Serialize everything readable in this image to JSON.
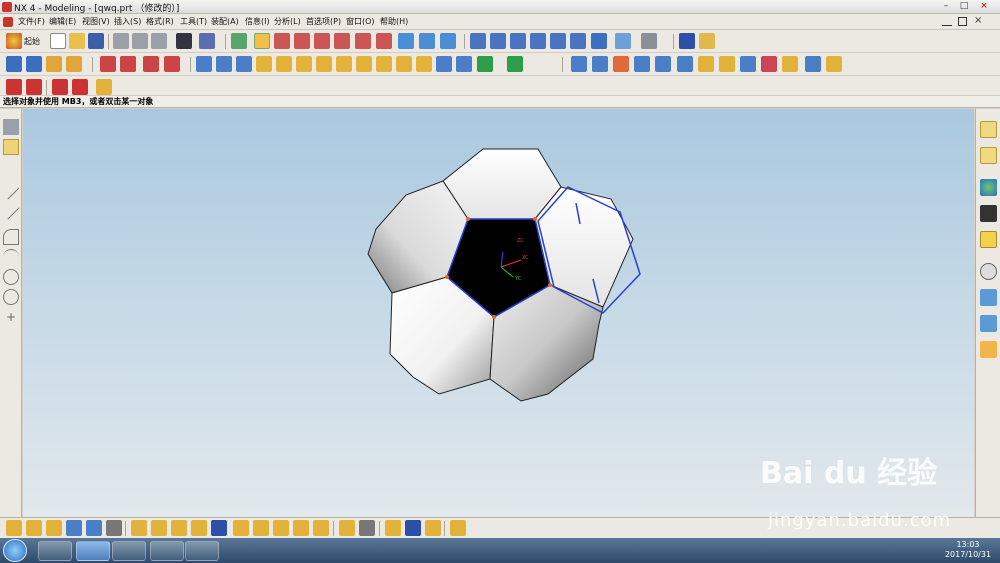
{
  "window": {
    "title": "NX 4 - Modeling - [qwq.prt （修改的）]",
    "controls": [
      "–",
      "□",
      "×"
    ]
  },
  "menu": {
    "items": [
      "文件(F)",
      "编辑(E)",
      "视图(V)",
      "插入(S)",
      "格式(R)",
      "工具(T)",
      "装配(A)",
      "信息(I)",
      "分析(L)",
      "首选项(P)",
      "窗口(O)",
      "帮助(H)"
    ]
  },
  "toolbar": {
    "start_label": "起始"
  },
  "status": {
    "message": "选择对象并使用 MB3，或者双击某一对象"
  },
  "viewport": {
    "axis_labels": [
      "XC",
      "YC",
      "ZC"
    ],
    "colors": {
      "selection": "#2a3fd1",
      "highlight_face": "#000000",
      "vertex": "#e06a1a"
    }
  },
  "taskbar": {
    "time": "13:03",
    "date": "2017/10/31"
  },
  "watermark": {
    "brand": "Bai du 经验",
    "url": "jingyan.baidu.com"
  },
  "icons": {
    "left": [
      "pointer-icon",
      "snap-icon",
      "line-icon",
      "line-icon",
      "arc-icon",
      "arc-icon",
      "circle-icon",
      "circle-icon",
      "point-icon"
    ],
    "right": [
      "assembly-navigator-icon",
      "part-navigator-icon",
      "web-browser-icon",
      "training-icon",
      "help-icon",
      "history-icon",
      "reuse-library-icon",
      "feature-icon",
      "roles-icon"
    ]
  }
}
